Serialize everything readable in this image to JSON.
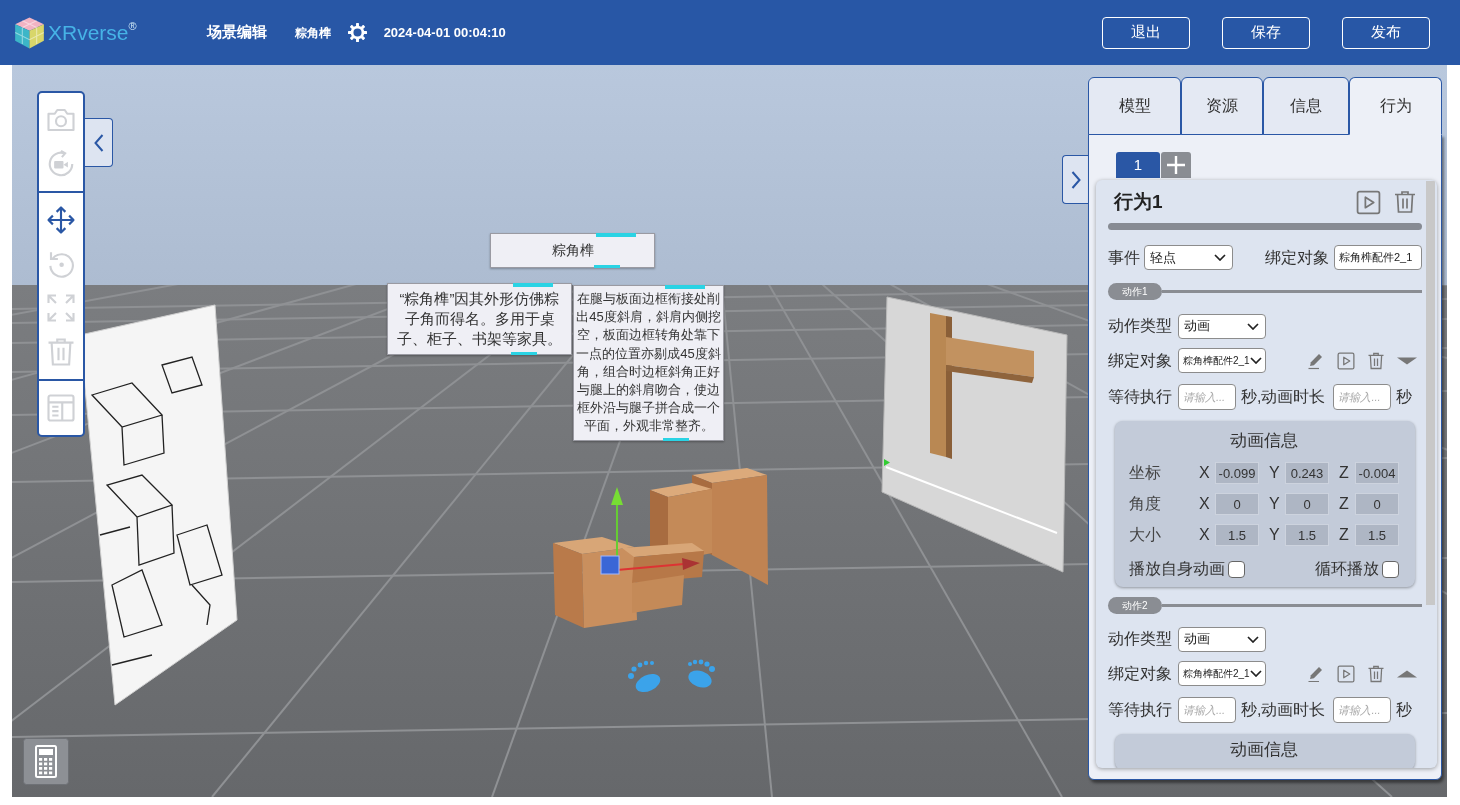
{
  "header": {
    "logo": "XRverse$^{®}$",
    "title": "场景编辑",
    "project": "粽角榫",
    "timestamp": "2024-04-01 00:04:10",
    "buttons": [
      "退出",
      "保存",
      "发布"
    ]
  },
  "toolbar": {
    "groups": [
      {
        "tools": [
          {
            "kind": "camera",
            "selected": false
          },
          {
            "kind": "record",
            "selected": false
          }
        ]
      },
      {
        "tools": [
          {
            "kind": "move",
            "selected": true
          },
          {
            "kind": "rotate",
            "selected": false
          },
          {
            "kind": "scale",
            "selected": false
          },
          {
            "kind": "delete",
            "selected": false
          }
        ]
      },
      {
        "tools": [
          {
            "kind": "layout",
            "selected": false
          }
        ]
      }
    ]
  },
  "scene": {
    "title_card": "粽角榫",
    "info_cards": [
      "“粽角榫”因其外形仿佛粽子角而得名。多用于桌子、柜子、书架等家具。",
      "在腿与板面边框衔接处削出45度斜肩，斜肩内侧挖空，板面边框转角处靠下一点的位置亦剔成45度斜角，组合时边框斜角正好与腿上的斜肩吻合，使边框外沿与腿子拼合成一个平面，外观非常整齐。"
    ]
  },
  "side_panel": {
    "tabs": [
      {
        "label": "模型",
        "selected": false
      },
      {
        "label": "资源",
        "selected": false
      },
      {
        "label": "信息",
        "selected": false
      },
      {
        "label": "行为",
        "selected": true
      }
    ],
    "behavior_tabs": [
      {
        "label": "1",
        "selected": true
      }
    ],
    "behavior": {
      "title": "行为1",
      "event": {
        "label": "事件",
        "value": "轻点"
      },
      "target": {
        "label": "绑定对象",
        "value": "粽角榫配件2_1"
      },
      "actions": [
        {
          "label": "动作1",
          "type": {
            "label": "动作类型",
            "value": "动画"
          },
          "target": {
            "label": "绑定对象",
            "value": "粽角榫配件2_1"
          },
          "caret_up": false,
          "wait": {
            "label": "等待执行",
            "placeholder": "请输入..."
          },
          "between": "秒,动画时长",
          "duration": {
            "placeholder": "请输入..."
          },
          "unit": "秒",
          "info": {
            "title": "动画信息",
            "rows": [
              {
                "label": "坐标",
                "values": [
                  {
                    "axis": "X",
                    "value": "-0.099"
                  },
                  {
                    "axis": "Y",
                    "value": "0.243"
                  },
                  {
                    "axis": "Z",
                    "value": "-0.004"
                  }
                ]
              },
              {
                "label": "角度",
                "values": [
                  {
                    "axis": "X",
                    "value": "0"
                  },
                  {
                    "axis": "Y",
                    "value": "0"
                  },
                  {
                    "axis": "Z",
                    "value": "0"
                  }
                ]
              },
              {
                "label": "大小",
                "values": [
                  {
                    "axis": "X",
                    "value": "1.5"
                  },
                  {
                    "axis": "Y",
                    "value": "1.5"
                  },
                  {
                    "axis": "Z",
                    "value": "1.5"
                  }
                ]
              }
            ],
            "options": [
              {
                "label": "播放自身动画",
                "checked": false
              },
              {
                "label": "循环播放",
                "checked": false
              }
            ]
          }
        },
        {
          "label": "动作2",
          "type": {
            "label": "动作类型",
            "value": "动画"
          },
          "target": {
            "label": "绑定对象",
            "value": "粽角榫配件2_1"
          },
          "caret_up": true,
          "wait": {
            "label": "等待执行",
            "placeholder": "请输入..."
          },
          "between": "秒,动画时长",
          "duration": {
            "placeholder": "请输入..."
          },
          "unit": "秒",
          "info": {
            "title": "动画信息"
          }
        }
      ]
    }
  }
}
